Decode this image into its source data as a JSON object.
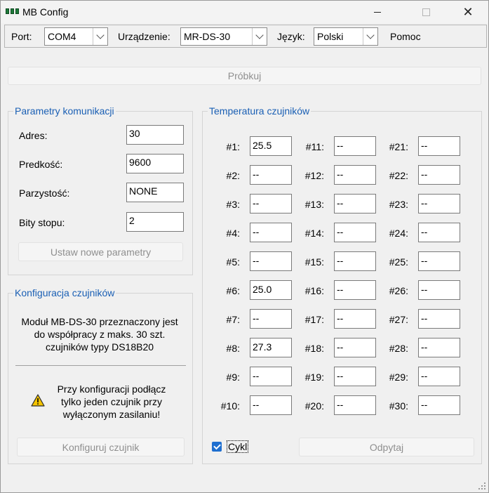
{
  "window": {
    "title": "MB Config"
  },
  "toolbar": {
    "port_label": "Port:",
    "port_value": "COM4",
    "device_label": "Urządzenie:",
    "device_value": "MR-DS-30",
    "lang_label": "Język:",
    "lang_value": "Polski",
    "help_label": "Pomoc"
  },
  "sample_button": "Próbkuj",
  "comm": {
    "title": "Parametry komunikacji",
    "params": [
      {
        "label": "Adres:",
        "value": "30"
      },
      {
        "label": "Predkość:",
        "value": "9600"
      },
      {
        "label": "Parzystość:",
        "value": "NONE"
      },
      {
        "label": "Bity stopu:",
        "value": "2"
      }
    ],
    "set_button": "Ustaw nowe parametry"
  },
  "config": {
    "title": "Konfiguracja czujników",
    "description": [
      "Moduł MB-DS-30 przeznaczony jest",
      "do współpracy z maks. 30 szt.",
      "czujników typy DS18B20"
    ],
    "warning": [
      "Przy konfiguracji podłącz",
      "tylko jeden czujnik przy",
      "wyłączonym zasilaniu!"
    ],
    "configure_button": "Konfiguruj czujnik"
  },
  "temps": {
    "title": "Temperatura czujników",
    "sensors": [
      {
        "label": "#1:",
        "value": "25.5"
      },
      {
        "label": "#2:",
        "value": "--"
      },
      {
        "label": "#3:",
        "value": "--"
      },
      {
        "label": "#4:",
        "value": "--"
      },
      {
        "label": "#5:",
        "value": "--"
      },
      {
        "label": "#6:",
        "value": "25.0"
      },
      {
        "label": "#7:",
        "value": "--"
      },
      {
        "label": "#8:",
        "value": "27.3"
      },
      {
        "label": "#9:",
        "value": "--"
      },
      {
        "label": "#10:",
        "value": "--"
      },
      {
        "label": "#11:",
        "value": "--"
      },
      {
        "label": "#12:",
        "value": "--"
      },
      {
        "label": "#13:",
        "value": "--"
      },
      {
        "label": "#14:",
        "value": "--"
      },
      {
        "label": "#15:",
        "value": "--"
      },
      {
        "label": "#16:",
        "value": "--"
      },
      {
        "label": "#17:",
        "value": "--"
      },
      {
        "label": "#18:",
        "value": "--"
      },
      {
        "label": "#19:",
        "value": "--"
      },
      {
        "label": "#20:",
        "value": "--"
      },
      {
        "label": "#21:",
        "value": "--"
      },
      {
        "label": "#22:",
        "value": "--"
      },
      {
        "label": "#23:",
        "value": "--"
      },
      {
        "label": "#24:",
        "value": "--"
      },
      {
        "label": "#25:",
        "value": "--"
      },
      {
        "label": "#26:",
        "value": "--"
      },
      {
        "label": "#27:",
        "value": "--"
      },
      {
        "label": "#28:",
        "value": "--"
      },
      {
        "label": "#29:",
        "value": "--"
      },
      {
        "label": "#30:",
        "value": "--"
      }
    ],
    "cycle_label": "Cykl",
    "cycle_checked": true,
    "read_button": "Odpytaj"
  },
  "colors": {
    "group_title": "#1a5fb4",
    "checkbox": "#1e6fd0",
    "disabled_text": "#8f8f8f"
  }
}
